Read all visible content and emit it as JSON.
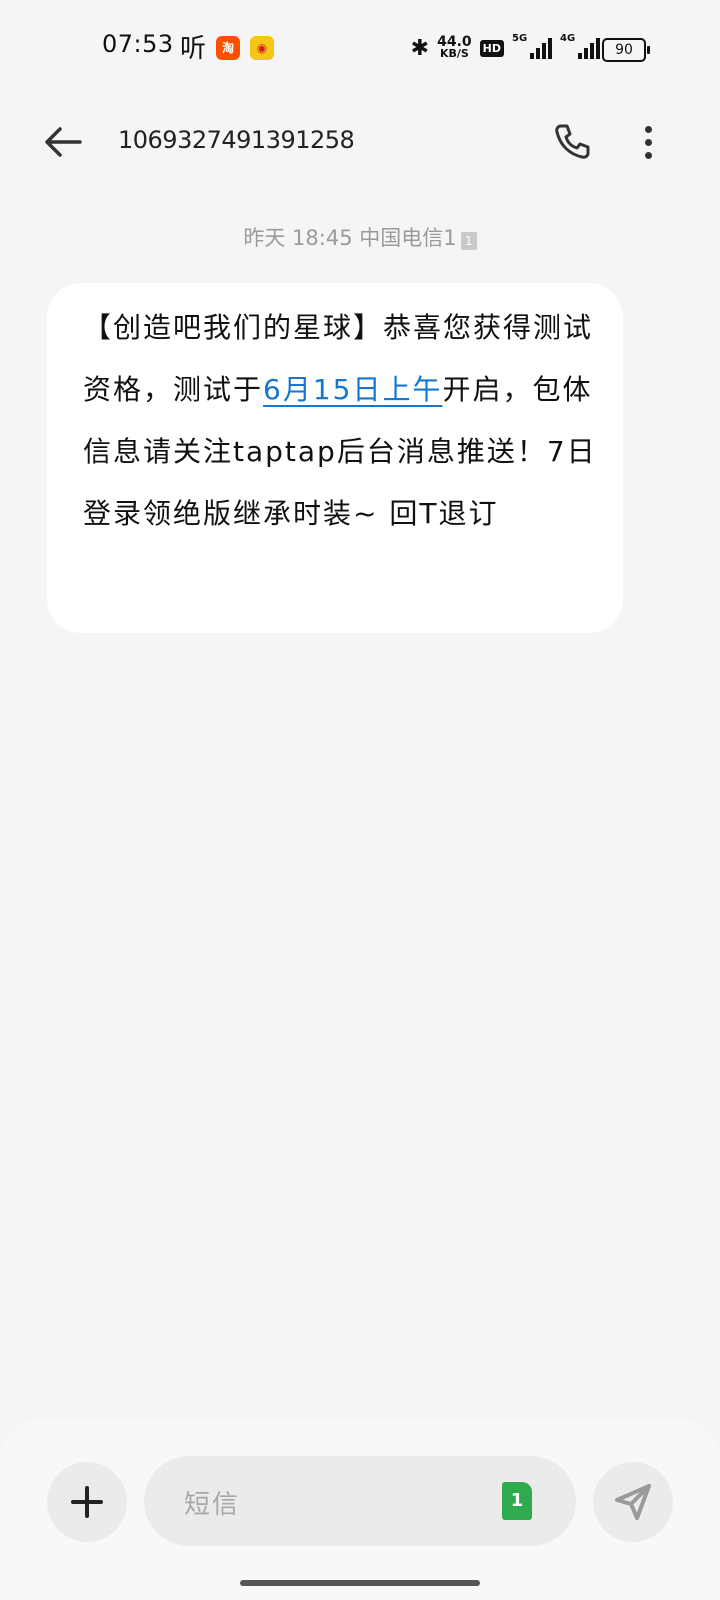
{
  "status_bar": {
    "time": "07:53",
    "ting": "听",
    "speed_value": "44.0",
    "speed_unit": "KB/S",
    "hd": "HD",
    "net1": "5G",
    "net2": "4G",
    "battery": "90"
  },
  "header": {
    "title": "1069327491391258"
  },
  "message": {
    "meta_day": "昨天",
    "meta_time": "18:45",
    "meta_sim": "中国电信1",
    "sim_badge": "1",
    "text_before": "【创造吧我们的星球】恭喜您获得测试资格，测试于",
    "text_link": "6月15日上午",
    "text_after": "开启，包体信息请关注taptap后台消息推送！7日登录领绝版继承时装~ 回T退订"
  },
  "composer": {
    "placeholder": "短信",
    "sim_label": "1"
  },
  "colors": {
    "link": "#1677d2",
    "sim_green": "#2eaa4f",
    "background": "#f5f5f5"
  }
}
